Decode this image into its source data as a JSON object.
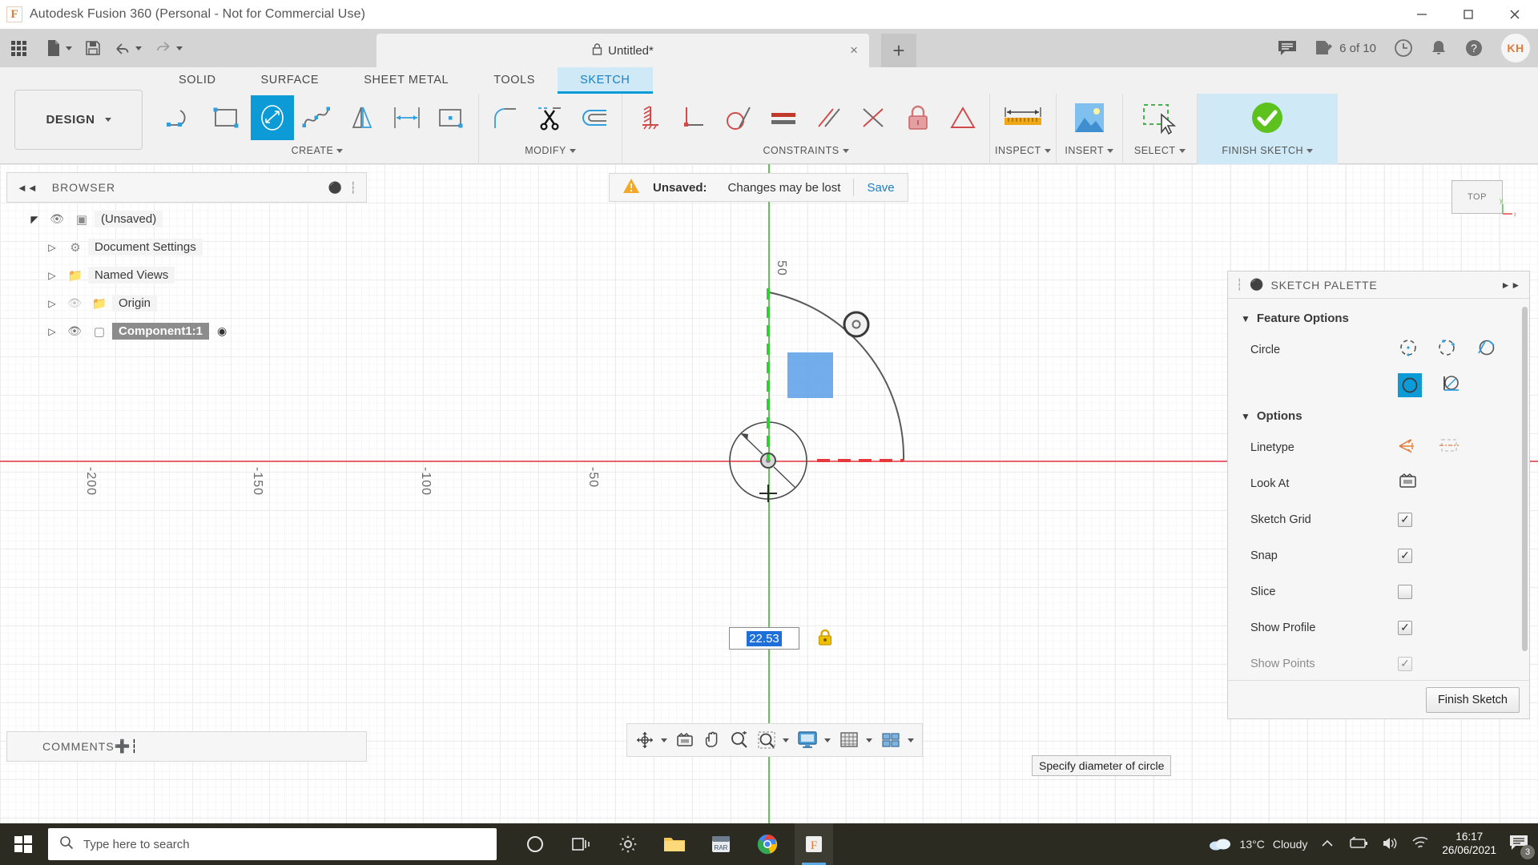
{
  "window": {
    "title": "Autodesk Fusion 360 (Personal - Not for Commercial Use)",
    "logo_letter": "F",
    "minimize": "minimize-icon",
    "maximize": "maximize-icon",
    "close": "close-icon"
  },
  "quick_access": {
    "apps_grid": "apps-grid-icon",
    "new_file": "new-file-icon",
    "save": "save-icon",
    "undo": "undo-icon",
    "redo": "redo-icon"
  },
  "tabs": {
    "document_name": "Untitled*",
    "lock_icon": "lock-icon",
    "close_label": "×",
    "add_label": "+"
  },
  "top_right": {
    "comments_icon": "comments-icon",
    "jobs_icon": "job-status-icon",
    "jobs_label": "6 of 10",
    "history_icon": "clock-icon",
    "notifications_icon": "bell-icon",
    "help_icon": "help-icon",
    "account_initials": "KH"
  },
  "ribbon": {
    "workspace_label": "DESIGN",
    "tabs": [
      {
        "label": "SOLID",
        "active": false
      },
      {
        "label": "SURFACE",
        "active": false
      },
      {
        "label": "SHEET METAL",
        "active": false
      },
      {
        "label": "TOOLS",
        "active": false
      },
      {
        "label": "SKETCH",
        "active": true
      }
    ],
    "panels": [
      {
        "label": "CREATE",
        "has_caret": true
      },
      {
        "label": "MODIFY",
        "has_caret": true
      },
      {
        "label": "CONSTRAINTS",
        "has_caret": true
      },
      {
        "label": "INSPECT",
        "has_caret": true
      },
      {
        "label": "INSERT",
        "has_caret": true
      },
      {
        "label": "SELECT",
        "has_caret": true
      },
      {
        "label": "FINISH SKETCH",
        "has_caret": true
      }
    ],
    "create_tools": [
      "line-tool",
      "rectangle-tool",
      "circle-tool-selected",
      "spline-tool",
      "mirror-tool",
      "dimension-tool",
      "point-rectangle-tool"
    ],
    "modify_tools": [
      "fillet-tool",
      "trim-tool",
      "offset-tool"
    ],
    "constraint_tools": [
      "fix-constraint",
      "perpendicular-constraint",
      "tangent-constraint",
      "equal-constraint",
      "parallel-constraint",
      "coincident-constraint",
      "lock-constraint",
      "symmetry-constraint"
    ]
  },
  "browser": {
    "title": "BROWSER",
    "collapse_icon": "collapse-icon",
    "drag_icon": "drag-handle-icon",
    "items": [
      {
        "label": "(Unsaved)",
        "indent": 0,
        "eye": true,
        "icon": "assembly-icon",
        "selected": false
      },
      {
        "label": "Document Settings",
        "indent": 1,
        "eye": false,
        "icon": "gear-icon",
        "selected": false
      },
      {
        "label": "Named Views",
        "indent": 1,
        "eye": false,
        "icon": "folder-icon",
        "selected": false
      },
      {
        "label": "Origin",
        "indent": 1,
        "eye": true,
        "icon": "folder-icon",
        "selected": false
      },
      {
        "label": "Component1:1",
        "indent": 1,
        "eye": true,
        "icon": "component-icon",
        "selected": true
      }
    ]
  },
  "comments": {
    "title": "COMMENTS",
    "add_icon": "add-comment-icon",
    "drag_icon": "drag-handle-icon"
  },
  "unsaved_banner": {
    "warning_icon": "warning-icon",
    "label": "Unsaved:",
    "message": "Changes may be lost",
    "save_link": "Save"
  },
  "viewcube": {
    "face_label": "TOP"
  },
  "canvas": {
    "ruler_ticks": [
      "-200",
      "-150",
      "-100",
      "-50",
      "50"
    ],
    "dimension_value": "22.53",
    "lock_icon": "lock-icon",
    "x_axis_color": "#e8666b",
    "y_axis_color": "#58c94a",
    "profile_fill": "#5a9fe8"
  },
  "sketch_palette": {
    "title": "SKETCH PALETTE",
    "collapse_icon": "collapse-icon",
    "expand_icon": "expand-right-icon",
    "sections": [
      {
        "title": "Feature Options",
        "rows": [
          {
            "name": "Circle",
            "type": "icon-group",
            "icons": [
              "center-diameter-circle-icon",
              "two-point-circle-icon",
              "three-point-circle-icon"
            ]
          },
          {
            "name": "",
            "type": "icon-group",
            "icons": [
              "two-tangent-circle-icon-selected",
              "three-tangent-circle-icon"
            ]
          }
        ]
      },
      {
        "title": "Options",
        "rows": [
          {
            "name": "Linetype",
            "type": "icon-group",
            "icons": [
              "construction-line-icon",
              "centerline-icon"
            ]
          },
          {
            "name": "Look At",
            "type": "icon-group",
            "icons": [
              "look-at-icon"
            ]
          },
          {
            "name": "Sketch Grid",
            "type": "checkbox",
            "checked": true
          },
          {
            "name": "Snap",
            "type": "checkbox",
            "checked": true
          },
          {
            "name": "Slice",
            "type": "checkbox",
            "checked": false
          },
          {
            "name": "Show Profile",
            "type": "checkbox",
            "checked": true
          },
          {
            "name": "Show Points",
            "type": "checkbox",
            "checked": true
          }
        ]
      }
    ],
    "footer_button": "Finish Sketch"
  },
  "navbar": {
    "items": [
      "orbit-icon",
      "look-at-icon",
      "pan-icon",
      "zoom-icon",
      "zoom-window-icon",
      "display-settings-icon",
      "grid-settings-icon",
      "viewports-icon"
    ]
  },
  "tooltip": {
    "text": "Specify diameter of circle"
  },
  "timeline": {
    "buttons": [
      "jump-to-start-icon",
      "step-back-icon",
      "play-icon",
      "step-forward-icon",
      "jump-to-end-icon",
      "sketch-feature-icon"
    ],
    "settings_icon": "gear-icon"
  },
  "taskbar": {
    "start_icon": "windows-start-icon",
    "search_placeholder": "Type here to search",
    "search_icon": "search-icon",
    "apps": [
      "cortana-icon",
      "task-view-icon",
      "settings-icon",
      "file-explorer-icon",
      "winrar-icon",
      "chrome-icon",
      "fusion360-icon"
    ],
    "weather_temp": "13°C",
    "weather_desc": "Cloudy",
    "chevron_icon": "chevron-up-icon",
    "battery_icon": "battery-icon",
    "volume_icon": "volume-icon",
    "network_icon": "wifi-icon",
    "time": "16:17",
    "date": "26/06/2021",
    "notification_count": "3"
  }
}
